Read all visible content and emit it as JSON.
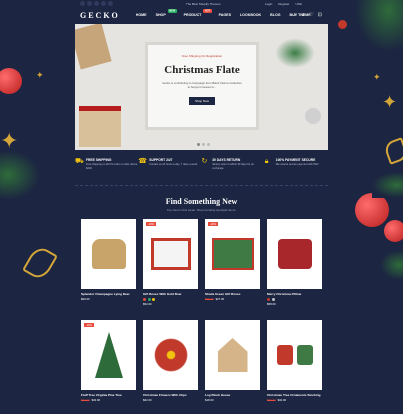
{
  "topbar": {
    "promo": "The Best Shopify Themes",
    "right": [
      "Login",
      "Register",
      "USD"
    ]
  },
  "nav": {
    "logo": "GECKO",
    "menu": [
      {
        "label": "HOME"
      },
      {
        "label": "SHOP",
        "badge": "NEW",
        "badge_color": "#27ae60"
      },
      {
        "label": "PRODUCT",
        "badge": "HOT",
        "badge_color": "#e74c3c"
      },
      {
        "label": "PAGES"
      },
      {
        "label": "LOOKBOOK"
      },
      {
        "label": "BLOG"
      },
      {
        "label": "BUY THEME"
      }
    ]
  },
  "hero": {
    "subtitle": "Free Shipping On Registration",
    "title": "Christmas Flate",
    "description": "Gecko is contributing to Campaign Zero Black Visions Collective to Support Causes fo...",
    "button": "Shop Now"
  },
  "features": [
    {
      "title": "FREE SHIPPING",
      "desc": "Free shipping on all US order or order above $200"
    },
    {
      "title": "SUPPORT 24/7",
      "desc": "Contact us 24 hours a day, 7 days a week"
    },
    {
      "title": "30 DAYS RETURN",
      "desc": "Simply return it within 30 days for an exchange."
    },
    {
      "title": "100% PAYMENT SECURE",
      "desc": "We ensure secure payment with PEV"
    }
  ],
  "section": {
    "title": "Find Something New",
    "subtitle": "Top view in this week. Shop trending spotlight items."
  },
  "products": [
    {
      "name": "Splendor Champagne Lying Deer",
      "old": "",
      "price": "$90.00",
      "sale": ""
    },
    {
      "name": "Gift Boxes With Gold Bow",
      "old": "",
      "price": "$52.00",
      "sale": "-10%",
      "swatches": [
        "#e74c3c",
        "#27ae60",
        "#f1c40f"
      ]
    },
    {
      "name": "Shade Green Gift Boxes",
      "old": "$35.00",
      "price": "$27.00",
      "sale": "-20%"
    },
    {
      "name": "Merry Christmas Pillow",
      "old": "",
      "price": "$58.00",
      "sale": "",
      "swatches": [
        "#c0392b",
        "#bdc3c7"
      ]
    },
    {
      "name": "Fluff Tree Virginia Pine Tree",
      "old": "$40.00",
      "price": "$32.00",
      "sale": "-20%"
    },
    {
      "name": "Christmas Flowers With Clips",
      "old": "",
      "price": "$62.00",
      "sale": ""
    },
    {
      "name": "Log Block House",
      "old": "",
      "price": "$18.00",
      "sale": ""
    },
    {
      "name": "Christmas Tree Ornaments Stocking",
      "old": "$39.00",
      "price": "$32.00",
      "sale": ""
    }
  ]
}
